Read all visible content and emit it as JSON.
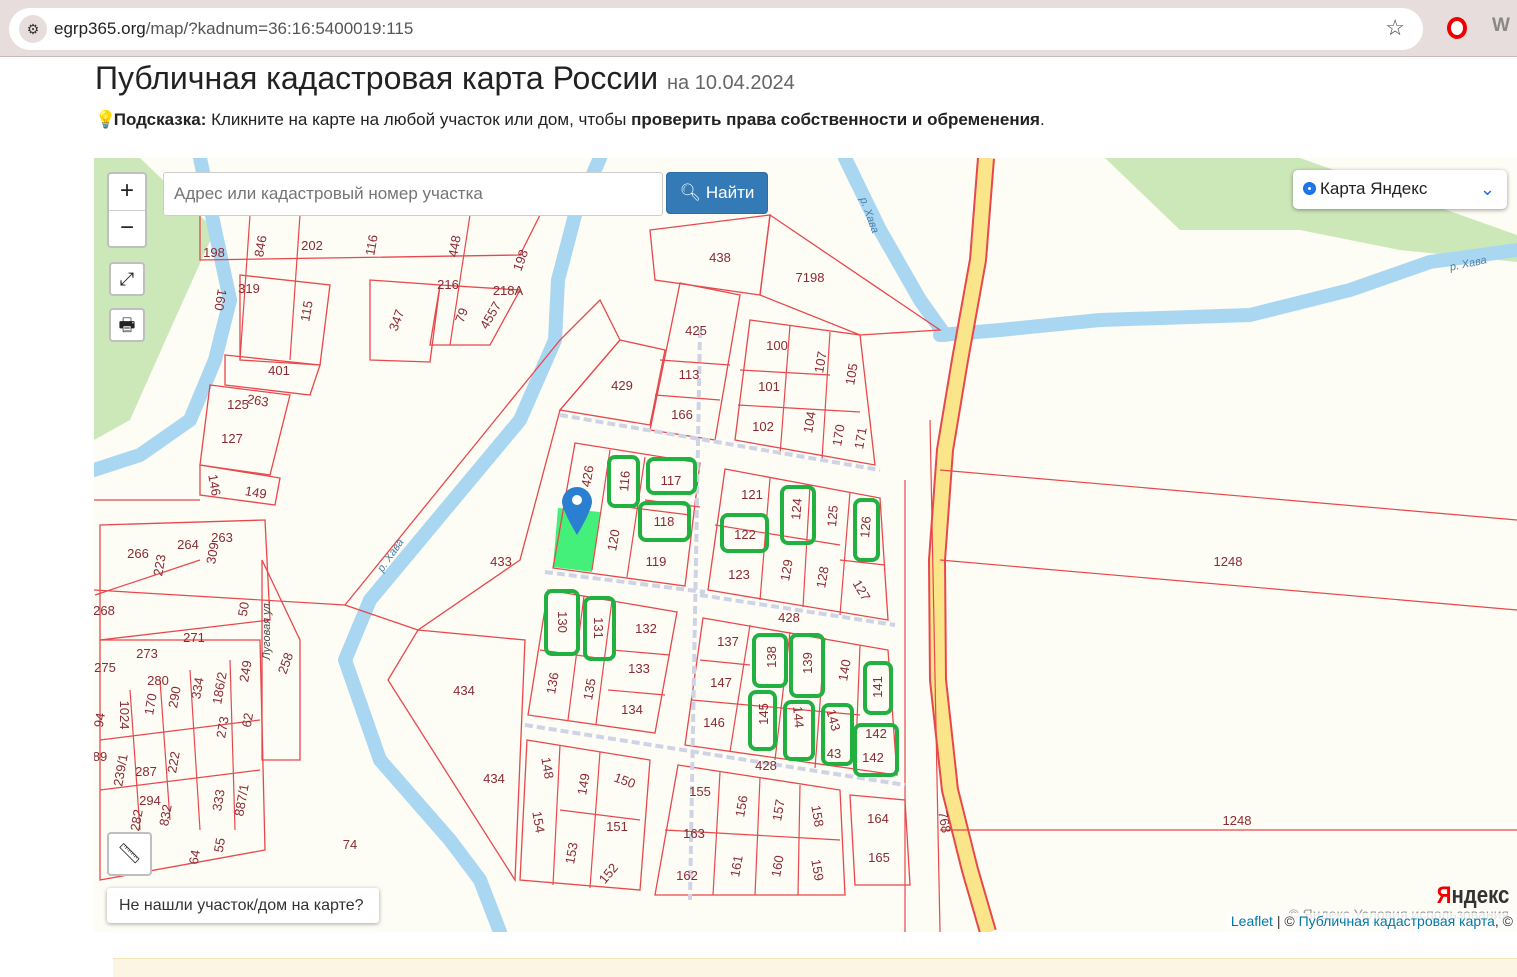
{
  "browser": {
    "url_host": "egrp365.org",
    "url_path": "/map/?kadnum=36:16:5400019:115"
  },
  "header": {
    "title": "Публичная кадастровая карта России",
    "date": "на 10.04.2024"
  },
  "hint": {
    "label": "Подсказка:",
    "text": " Кликните на карте на любой участок или дом, чтобы ",
    "bold": "проверить права собственности и обременения",
    "end": "."
  },
  "map": {
    "zoom_in": "+",
    "zoom_out": "−",
    "search_placeholder": "Адрес или кадастровый номер участка",
    "find_label": "Найти",
    "layer_selected": "Карта Яндекс",
    "not_found": "Не нашли участок/дом на карте?",
    "attribution": {
      "leaflet": "Leaflet",
      "sep": " | © ",
      "pkk": "Публичная кадастровая карта",
      "tail": ", ©",
      "yandex_copy": "© Яндекс  Условия использования",
      "logo_ya": "Я",
      "logo_rest": "ндекс"
    },
    "street_labels": [
      "Луговая ул.",
      "р. Хава",
      "р. Хава",
      "р. Хава"
    ],
    "parcel_labels": [
      "438",
      "7198",
      "425",
      "429",
      "113",
      "166",
      "100",
      "107",
      "105",
      "101",
      "102",
      "104",
      "170",
      "171",
      "426",
      "116",
      "117",
      "118",
      "121",
      "124",
      "125",
      "126",
      "120",
      "122",
      "119",
      "123",
      "129",
      "128",
      "127",
      "433",
      "1248",
      "428",
      "130",
      "131",
      "132",
      "137",
      "138",
      "139",
      "140",
      "141",
      "133",
      "147",
      "434",
      "136",
      "135",
      "134",
      "146",
      "145",
      "144",
      "143",
      "142",
      "43",
      "142",
      "428",
      "434",
      "148",
      "149",
      "150",
      "155",
      "156",
      "157",
      "158",
      "164",
      "1248",
      "154",
      "151",
      "163",
      "165",
      "153",
      "152",
      "162",
      "161",
      "160",
      "159",
      "768",
      "74",
      "198",
      "846",
      "202",
      "116",
      "448",
      "198",
      "216",
      "218А",
      "319",
      "160",
      "115",
      "347",
      "79",
      "4557",
      "401",
      "263",
      "125",
      "127",
      "149",
      "146",
      "266",
      "264",
      "263",
      "223",
      "309",
      "268",
      "50",
      "271",
      "273",
      "275",
      "280",
      "258",
      "249",
      "186/2",
      "334",
      "290",
      "170",
      "1024",
      "273",
      "62",
      "94",
      "222",
      "287",
      "239/1",
      "89",
      "294",
      "333",
      "887/1",
      "832",
      "282",
      "55",
      "64"
    ],
    "highlighted_parcels": [
      "116",
      "117",
      "118",
      "122",
      "124",
      "126",
      "130",
      "131",
      "138",
      "139",
      "141",
      "145",
      "144",
      "143",
      "142"
    ],
    "colors": {
      "parcel_line": "#e8474c",
      "highlight": "#22b040",
      "selected_fill": "#45f07a",
      "river": "#a9d7f2",
      "forest": "#cde8b8",
      "road": "#fbe58a",
      "marker": "#2b7fd0"
    }
  }
}
